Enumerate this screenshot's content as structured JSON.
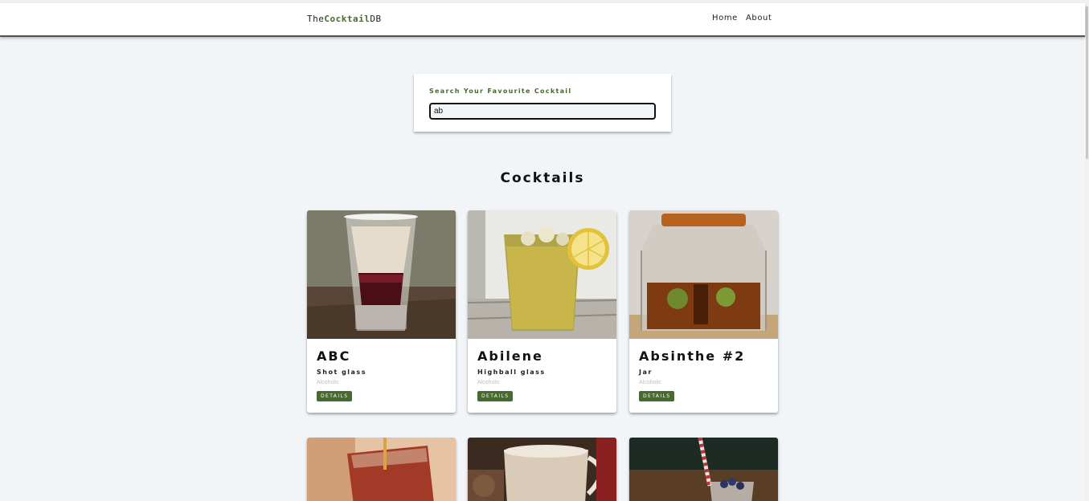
{
  "navbar": {
    "logo_prefix": "The",
    "logo_brand": "Cocktail",
    "logo_suffix": "DB",
    "links": [
      "Home",
      "About"
    ]
  },
  "search": {
    "label": "Search Your Favourite Cocktail",
    "value": "ab"
  },
  "section_title": "Cocktails",
  "cocktails": [
    {
      "name": "ABC",
      "glass": "Shot glass",
      "type": "Alcoholic",
      "button": "DETAILS",
      "image": "layered-shot-glass-image"
    },
    {
      "name": "Abilene",
      "glass": "Highball glass",
      "type": "Alcoholic",
      "button": "DETAILS",
      "image": "lemon-highball-image"
    },
    {
      "name": "Absinthe #2",
      "glass": "Jar",
      "type": "Alcoholic",
      "button": "DETAILS",
      "image": "preserving-jar-image"
    },
    {
      "image": "red-drink-image"
    },
    {
      "image": "creamy-iced-drink-image"
    },
    {
      "image": "berry-parfait-image"
    }
  ],
  "colors": {
    "accent": "#476a2e",
    "background": "#f1f5f8"
  }
}
